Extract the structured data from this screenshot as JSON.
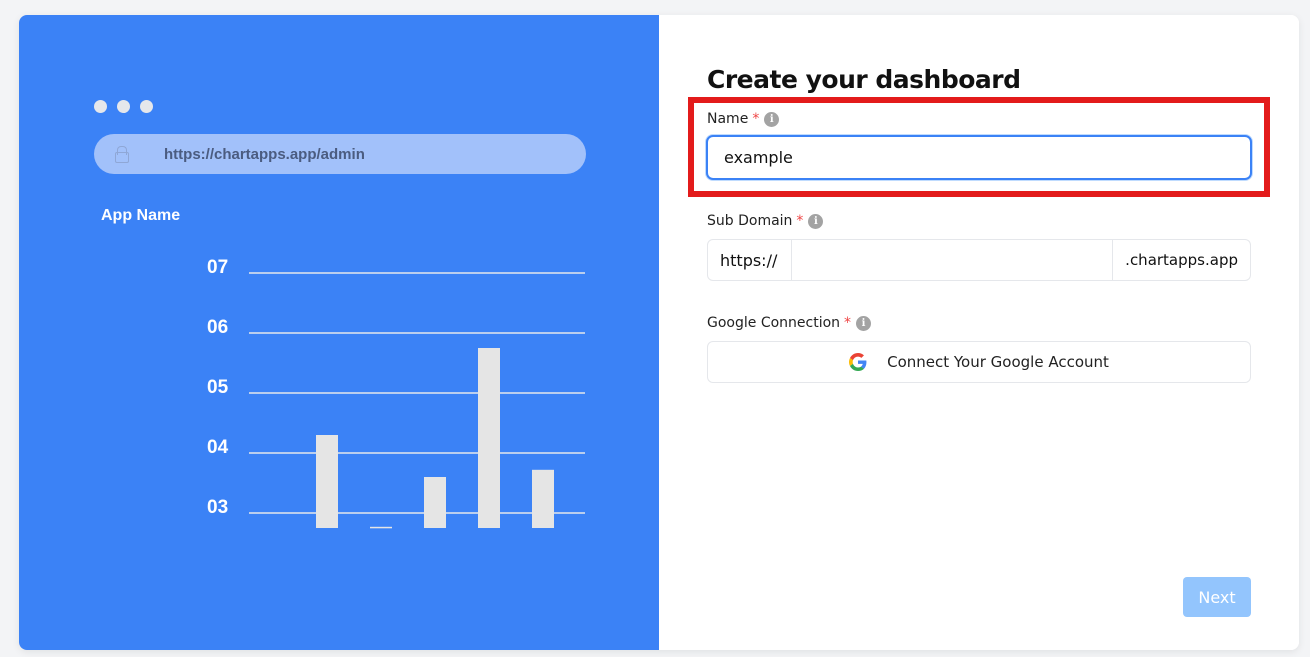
{
  "illustration": {
    "url": "https://chartapps.app/admin",
    "app_name": "App Name",
    "chart_data": {
      "type": "bar",
      "y_tick_labels": [
        "07",
        "06",
        "05",
        "04",
        "03"
      ],
      "ylim": [
        2.75,
        7
      ],
      "values": [
        4.3,
        2.77,
        3.6,
        5.75,
        3.72
      ],
      "grid": true,
      "bar_color": "#e5e5e5"
    }
  },
  "form": {
    "title": "Create your dashboard",
    "name_label": "Name",
    "name_value": "example",
    "subdomain_label": "Sub Domain",
    "subdomain_prefix": "https://",
    "subdomain_value": "",
    "subdomain_suffix": ".chartapps.app",
    "google_label": "Google Connection",
    "google_button": "Connect Your Google Account",
    "required_mark": "*",
    "info_glyph": "i",
    "next_label": "Next"
  },
  "colors": {
    "primary": "#3b82f6",
    "highlight": "#e31b1b",
    "next_disabled": "#93c5fd"
  }
}
